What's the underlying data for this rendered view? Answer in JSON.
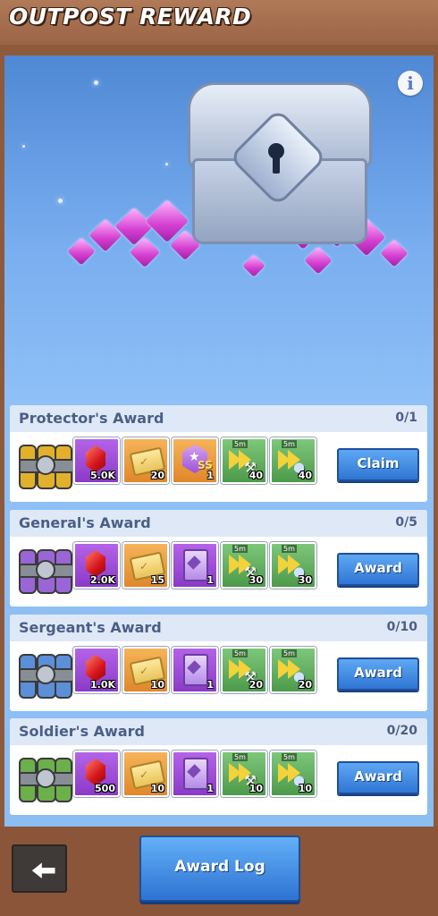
{
  "header": {
    "title": "OUTPOST REWARD"
  },
  "hero": {
    "info_label": "i"
  },
  "awards": [
    {
      "title": "Protector's Award",
      "progress": "0/1",
      "crate_color": "#e3b02c",
      "items": [
        {
          "kind": "ruby",
          "color": "purple",
          "qty": "5.0K"
        },
        {
          "kind": "ticket",
          "color": "orange",
          "qty": "20"
        },
        {
          "kind": "ss-badge",
          "color": "orange",
          "qty": "1",
          "badge": "SS"
        },
        {
          "kind": "speedup-tool",
          "color": "green",
          "qty": "40",
          "tag": "5m"
        },
        {
          "kind": "speedup-flask",
          "color": "green",
          "qty": "40",
          "tag": "5m"
        }
      ],
      "button": "Claim"
    },
    {
      "title": "General's Award",
      "progress": "0/5",
      "crate_color": "#9a66d6",
      "items": [
        {
          "kind": "ruby",
          "color": "purple",
          "qty": "2.0K"
        },
        {
          "kind": "ticket",
          "color": "orange",
          "qty": "15"
        },
        {
          "kind": "card",
          "color": "purple",
          "qty": "1"
        },
        {
          "kind": "speedup-tool",
          "color": "green",
          "qty": "30",
          "tag": "5m"
        },
        {
          "kind": "speedup-flask",
          "color": "green",
          "qty": "30",
          "tag": "5m"
        }
      ],
      "button": "Award"
    },
    {
      "title": "Sergeant's Award",
      "progress": "0/10",
      "crate_color": "#5b8fd8",
      "items": [
        {
          "kind": "ruby",
          "color": "purple",
          "qty": "1.0K"
        },
        {
          "kind": "ticket",
          "color": "orange",
          "qty": "10"
        },
        {
          "kind": "card",
          "color": "purple",
          "qty": "1"
        },
        {
          "kind": "speedup-tool",
          "color": "green",
          "qty": "20",
          "tag": "5m"
        },
        {
          "kind": "speedup-flask",
          "color": "green",
          "qty": "20",
          "tag": "5m"
        }
      ],
      "button": "Award"
    },
    {
      "title": "Soldier's Award",
      "progress": "0/20",
      "crate_color": "#6bb04a",
      "items": [
        {
          "kind": "ruby",
          "color": "purple",
          "qty": "500"
        },
        {
          "kind": "ticket",
          "color": "orange",
          "qty": "10"
        },
        {
          "kind": "card",
          "color": "purple",
          "qty": "1"
        },
        {
          "kind": "speedup-tool",
          "color": "green",
          "qty": "10",
          "tag": "5m"
        },
        {
          "kind": "speedup-flask",
          "color": "green",
          "qty": "10",
          "tag": "5m"
        }
      ],
      "button": "Award"
    }
  ],
  "footer": {
    "back_icon": "back-arrow-icon",
    "award_log_label": "Award Log"
  }
}
